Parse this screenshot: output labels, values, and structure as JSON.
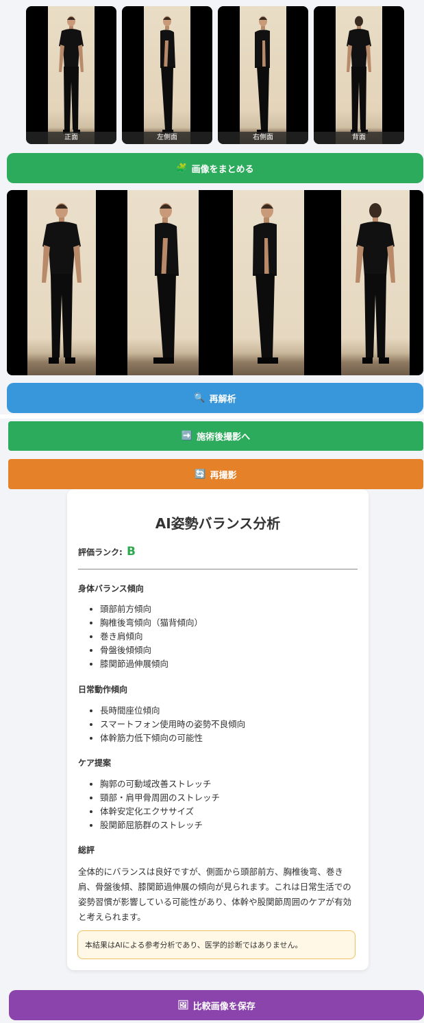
{
  "thumbnails": [
    {
      "label": "正面"
    },
    {
      "label": "左側面"
    },
    {
      "label": "右側面"
    },
    {
      "label": "背面"
    }
  ],
  "buttons": {
    "merge": {
      "icon": "🧩",
      "label": "画像をまとめる",
      "color": "#2bab5b"
    },
    "reanalyze": {
      "icon": "🔍",
      "label": "再解析",
      "color": "#3896db"
    },
    "after_shoot": {
      "icon": "➡️",
      "label": "施術後撮影へ",
      "color": "#2bab5b"
    },
    "retake": {
      "icon": "🔄",
      "label": "再撮影",
      "color": "#e58229"
    },
    "save": {
      "icon": "🖼",
      "label": "比較画像を保存",
      "color": "#8b44ac"
    }
  },
  "analysis": {
    "title": "AI姿勢バランス分析",
    "rank_label": "評価ランク:",
    "rank_value": "B",
    "body_balance": {
      "heading": "身体バランス傾向",
      "items": [
        "頭部前方傾向",
        "胸椎後弯傾向（猫背傾向）",
        "巻き肩傾向",
        "骨盤後傾傾向",
        "膝関節過伸展傾向"
      ]
    },
    "daily": {
      "heading": "日常動作傾向",
      "items": [
        "長時間座位傾向",
        "スマートフォン使用時の姿勢不良傾向",
        "体幹筋力低下傾向の可能性"
      ]
    },
    "care": {
      "heading": "ケア提案",
      "items": [
        "胸郭の可動域改善ストレッチ",
        "頸部・肩甲骨周囲のストレッチ",
        "体幹安定化エクササイズ",
        "股関節屈筋群のストレッチ"
      ]
    },
    "summary": {
      "heading": "総評",
      "text": "全体的にバランスは良好ですが、側面から頭部前方、胸椎後弯、巻き肩、骨盤後傾、膝関節過伸展の傾向が見られます。これは日常生活での姿勢習慣が影響している可能性があり、体幹や股関節周囲のケアが有効と考えられます。"
    },
    "disclaimer": "本結果はAIによる参考分析であり、医学的診断ではありません。"
  }
}
